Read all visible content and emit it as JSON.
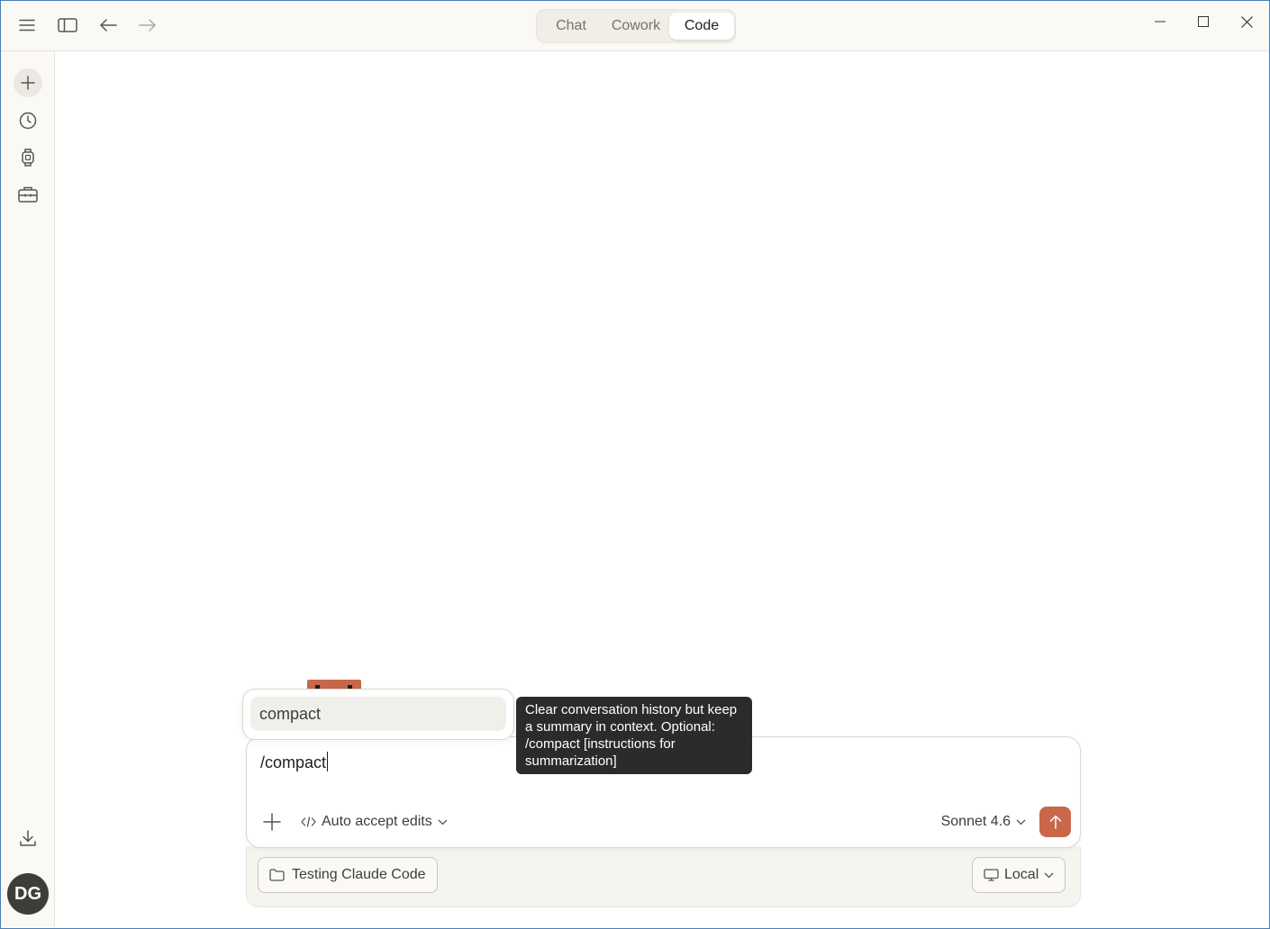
{
  "titlebar": {
    "menu_icon": "hamburger-icon",
    "sidebar_toggle_icon": "sidebar-toggle-icon",
    "back_icon": "arrow-left-icon",
    "forward_icon": "arrow-right-icon",
    "tabs": [
      {
        "label": "Chat",
        "active": false
      },
      {
        "label": "Cowork",
        "active": false
      },
      {
        "label": "Code",
        "active": true
      }
    ],
    "window_controls": [
      "minimize-icon",
      "maximize-icon",
      "close-icon"
    ]
  },
  "sidebar": {
    "items": [
      {
        "icon": "plus-icon",
        "name": "new-session"
      },
      {
        "icon": "clock-icon",
        "name": "history"
      },
      {
        "icon": "watch-icon",
        "name": "scheduled"
      },
      {
        "icon": "toolbox-icon",
        "name": "tools"
      }
    ],
    "download_icon": "download-icon",
    "avatar_initials": "DG"
  },
  "autocomplete": {
    "items": [
      {
        "label": "compact",
        "selected": true
      }
    ],
    "tooltip": "Clear conversation history but keep a summary in context. Optional: /compact [instructions for summarization]"
  },
  "composer": {
    "input_value": "/compact",
    "attach_icon": "plus-icon",
    "mode_label": "Auto accept edits",
    "mode_icon": "code-icon",
    "model_label": "Sonnet 4.6",
    "send_icon": "arrow-up-icon"
  },
  "footer": {
    "folder_label": "Testing Claude Code",
    "folder_icon": "folder-icon",
    "environment_label": "Local",
    "environment_icon": "monitor-icon"
  },
  "colors": {
    "accent": "#c9674a",
    "sidebar_bg": "#faf9f5",
    "tooltip_bg": "#2b2b2a"
  }
}
